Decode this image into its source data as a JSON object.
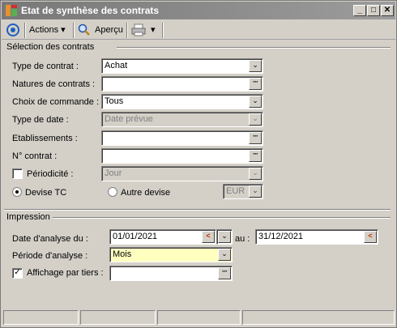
{
  "window": {
    "title": "Etat de synthèse des contrats",
    "minimize": "_",
    "maximize": "□",
    "close": "✕"
  },
  "toolbar": {
    "actions_label": "Actions",
    "preview_label": "Aperçu"
  },
  "selection": {
    "title": "Sélection des contrats",
    "type_contrat": {
      "label": "Type de contrat :",
      "value": "Achat"
    },
    "natures": {
      "label": "Natures de contrats :",
      "value": ""
    },
    "choix_commande": {
      "label": "Choix de commande :",
      "value": "Tous"
    },
    "type_date": {
      "label": "Type de date :",
      "value": "Date prévue"
    },
    "etablissements": {
      "label": "Etablissements :",
      "value": ""
    },
    "num_contrat": {
      "label": "N° contrat :",
      "value": ""
    },
    "periodicite": {
      "label": "Périodicité :",
      "value": "Jour",
      "checked": false
    },
    "devise_tc": {
      "label": "Devise TC",
      "selected": true
    },
    "autre_devise": {
      "label": "Autre devise",
      "value": "EUR",
      "selected": false
    }
  },
  "impression": {
    "title": "Impression",
    "date_analyse": {
      "label": "Date d'analyse du :",
      "from": "01/01/2021",
      "au_label": "au :",
      "to": "31/12/2021"
    },
    "periode": {
      "label": "Période d'analyse :",
      "value": "Mois"
    },
    "affichage_tiers": {
      "label": "Affichage par tiers :",
      "value": "",
      "checked": true
    }
  },
  "glyphs": {
    "chevron": "⌄",
    "dots": "···",
    "check": "✓",
    "caret": "▾",
    "cal_arrow": "<"
  }
}
